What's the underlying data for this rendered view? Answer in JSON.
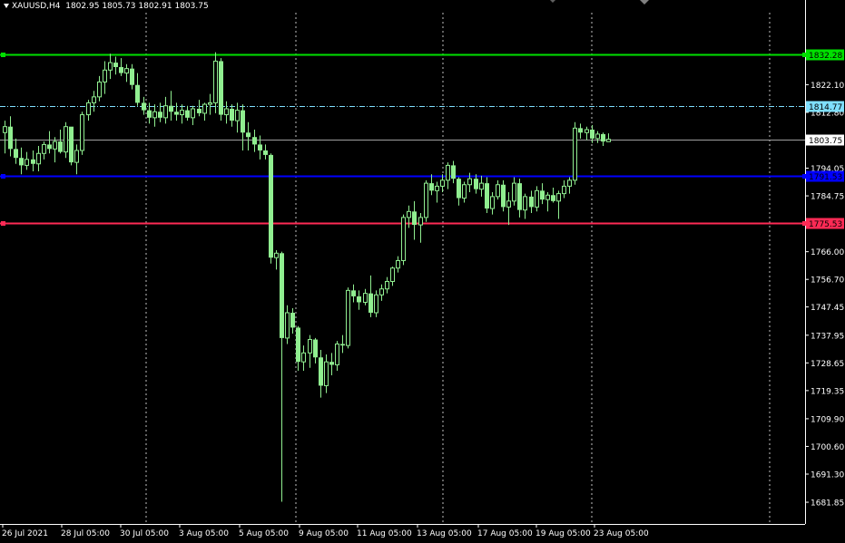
{
  "header": {
    "symbol": "XAUUSD,H4",
    "ohlc": "1802.95 1805.73 1802.91 1803.75"
  },
  "colors": {
    "background": "#000000",
    "candle": "#90ee90",
    "axis_text": "#ffffff",
    "grid": "#bfbfbf",
    "level_green": "#00e000",
    "level_cyan": "#7fdfff",
    "level_blue": "#0000ff",
    "level_red": "#ff2a55",
    "bid_line": "#a0a0a0"
  },
  "chart_data": {
    "type": "candlestick",
    "ylim": [
      1677.6,
      1841.4
    ],
    "y_ticks": [
      "1822.10",
      "1812.80",
      "1794.05",
      "1784.75",
      "1766.00",
      "1756.70",
      "1747.45",
      "1737.95",
      "1728.65",
      "1719.35",
      "1709.90",
      "1700.60",
      "1691.30",
      "1681.85"
    ],
    "x_ticks": [
      "26 Jul 2021",
      "28 Jul 05:00",
      "30 Jul 05:00",
      "3 Aug 05:00",
      "5 Aug 05:00",
      "9 Aug 05:00",
      "11 Aug 05:00",
      "13 Aug 05:00",
      "17 Aug 05:00",
      "19 Aug 05:00",
      "23 Aug 05:00"
    ],
    "levels": [
      {
        "price": 1832.28,
        "label": "1832.28",
        "style": "solid",
        "color": "level_green"
      },
      {
        "price": 1814.77,
        "label": "1814.77",
        "style": "dashdot",
        "color": "level_cyan"
      },
      {
        "price": 1803.75,
        "label": "1803.75",
        "style": "bid",
        "color": "bid_line"
      },
      {
        "price": 1791.53,
        "label": "1791.53",
        "style": "solid",
        "color": "level_blue"
      },
      {
        "price": 1775.53,
        "label": "1775.53",
        "style": "solid",
        "color": "level_red"
      }
    ],
    "candles": [
      [
        1806.0,
        1810.0,
        1799.0,
        1808.0
      ],
      [
        1808.0,
        1811.5,
        1798.0,
        1800.5
      ],
      [
        1800.5,
        1804.0,
        1795.5,
        1797.5
      ],
      [
        1797.5,
        1801.0,
        1792.0,
        1795.0
      ],
      [
        1795.0,
        1799.5,
        1793.5,
        1797.0
      ],
      [
        1797.0,
        1800.0,
        1793.0,
        1795.5
      ],
      [
        1795.5,
        1801.5,
        1793.0,
        1799.0
      ],
      [
        1799.0,
        1803.0,
        1797.0,
        1802.0
      ],
      [
        1802.0,
        1806.5,
        1799.0,
        1800.5
      ],
      [
        1800.5,
        1804.5,
        1796.0,
        1803.0
      ],
      [
        1803.0,
        1807.0,
        1799.0,
        1799.5
      ],
      [
        1799.5,
        1809.5,
        1797.5,
        1808.0
      ],
      [
        1808.0,
        1806.5,
        1795.0,
        1796.0
      ],
      [
        1796.0,
        1802.0,
        1792.0,
        1800.0
      ],
      [
        1800.0,
        1813.0,
        1798.5,
        1812.0
      ],
      [
        1812.0,
        1817.0,
        1810.0,
        1816.0
      ],
      [
        1816.0,
        1820.0,
        1813.0,
        1818.0
      ],
      [
        1818.0,
        1825.0,
        1816.5,
        1823.0
      ],
      [
        1823.0,
        1830.0,
        1819.0,
        1827.0
      ],
      [
        1827.0,
        1832.5,
        1824.0,
        1829.5
      ],
      [
        1829.5,
        1831.5,
        1825.5,
        1828.0
      ],
      [
        1828.0,
        1831.0,
        1825.0,
        1826.0
      ],
      [
        1826.0,
        1829.0,
        1823.0,
        1827.5
      ],
      [
        1827.5,
        1829.0,
        1820.5,
        1822.0
      ],
      [
        1822.0,
        1826.0,
        1815.0,
        1816.0
      ],
      [
        1816.0,
        1818.0,
        1812.0,
        1813.5
      ],
      [
        1813.5,
        1816.0,
        1809.0,
        1811.0
      ],
      [
        1811.0,
        1815.5,
        1808.0,
        1813.0
      ],
      [
        1813.0,
        1816.0,
        1809.5,
        1811.0
      ],
      [
        1811.0,
        1818.0,
        1809.0,
        1815.0
      ],
      [
        1815.0,
        1820.0,
        1810.0,
        1813.0
      ],
      [
        1813.0,
        1816.0,
        1810.0,
        1812.0
      ],
      [
        1812.0,
        1815.5,
        1809.0,
        1813.5
      ],
      [
        1813.5,
        1815.0,
        1810.0,
        1811.0
      ],
      [
        1811.0,
        1815.0,
        1808.5,
        1814.0
      ],
      [
        1814.0,
        1817.0,
        1811.5,
        1812.5
      ],
      [
        1812.5,
        1816.0,
        1810.0,
        1815.5
      ],
      [
        1815.5,
        1819.0,
        1812.0,
        1816.0
      ],
      [
        1816.0,
        1833.0,
        1812.5,
        1830.0
      ],
      [
        1830.0,
        1831.0,
        1810.0,
        1812.0
      ],
      [
        1812.0,
        1816.5,
        1809.0,
        1814.0
      ],
      [
        1814.0,
        1815.5,
        1808.0,
        1810.0
      ],
      [
        1810.0,
        1816.0,
        1806.0,
        1813.5
      ],
      [
        1813.5,
        1815.5,
        1800.0,
        1806.0
      ],
      [
        1806.0,
        1809.5,
        1800.0,
        1804.5
      ],
      [
        1804.5,
        1807.0,
        1799.5,
        1802.0
      ],
      [
        1802.0,
        1805.0,
        1797.0,
        1800.0
      ],
      [
        1800.0,
        1802.0,
        1797.0,
        1798.5
      ],
      [
        1798.5,
        1799.0,
        1762.0,
        1764.0
      ],
      [
        1764.0,
        1766.5,
        1760.0,
        1765.5
      ],
      [
        1765.5,
        1766.0,
        1682.0,
        1737.0
      ],
      [
        1737.0,
        1748.0,
        1735.0,
        1745.5
      ],
      [
        1745.5,
        1747.0,
        1738.5,
        1740.5
      ],
      [
        1740.5,
        1741.0,
        1726.0,
        1729.0
      ],
      [
        1729.0,
        1734.5,
        1726.0,
        1732.0
      ],
      [
        1732.0,
        1738.0,
        1727.0,
        1736.5
      ],
      [
        1736.5,
        1737.0,
        1728.5,
        1730.5
      ],
      [
        1730.5,
        1733.0,
        1717.0,
        1721.0
      ],
      [
        1721.0,
        1731.5,
        1718.5,
        1729.0
      ],
      [
        1729.0,
        1732.0,
        1724.5,
        1728.0
      ],
      [
        1728.0,
        1736.0,
        1726.0,
        1735.0
      ],
      [
        1735.0,
        1738.0,
        1732.0,
        1734.5
      ],
      [
        1734.5,
        1754.0,
        1733.5,
        1753.0
      ],
      [
        1753.0,
        1755.0,
        1749.0,
        1751.0
      ],
      [
        1751.0,
        1753.0,
        1746.5,
        1749.0
      ],
      [
        1749.0,
        1753.5,
        1748.0,
        1752.0
      ],
      [
        1752.0,
        1758.0,
        1744.0,
        1745.5
      ],
      [
        1745.5,
        1753.0,
        1744.0,
        1751.5
      ],
      [
        1751.5,
        1755.0,
        1749.5,
        1753.5
      ],
      [
        1753.5,
        1757.5,
        1752.0,
        1756.0
      ],
      [
        1756.0,
        1761.0,
        1754.5,
        1760.5
      ],
      [
        1760.5,
        1764.5,
        1759.0,
        1763.0
      ],
      [
        1763.0,
        1778.5,
        1761.5,
        1777.5
      ],
      [
        1777.5,
        1781.5,
        1774.0,
        1779.5
      ],
      [
        1779.5,
        1783.0,
        1770.0,
        1775.0
      ],
      [
        1775.0,
        1779.0,
        1769.0,
        1777.5
      ],
      [
        1777.5,
        1790.0,
        1776.0,
        1789.0
      ],
      [
        1789.0,
        1792.0,
        1785.0,
        1786.5
      ],
      [
        1786.5,
        1789.5,
        1782.5,
        1788.0
      ],
      [
        1788.0,
        1792.0,
        1786.0,
        1790.0
      ],
      [
        1790.0,
        1796.0,
        1787.0,
        1795.0
      ],
      [
        1795.0,
        1796.5,
        1789.0,
        1790.5
      ],
      [
        1790.5,
        1791.0,
        1781.5,
        1784.0
      ],
      [
        1784.0,
        1789.5,
        1782.5,
        1788.5
      ],
      [
        1788.5,
        1792.5,
        1786.0,
        1790.5
      ],
      [
        1790.5,
        1792.0,
        1785.5,
        1787.0
      ],
      [
        1787.0,
        1791.5,
        1784.5,
        1789.0
      ],
      [
        1789.0,
        1791.0,
        1779.0,
        1780.5
      ],
      [
        1780.5,
        1786.0,
        1778.5,
        1784.5
      ],
      [
        1784.5,
        1790.0,
        1783.5,
        1788.5
      ],
      [
        1788.5,
        1790.0,
        1779.5,
        1781.0
      ],
      [
        1781.0,
        1786.0,
        1775.0,
        1783.0
      ],
      [
        1783.0,
        1791.0,
        1781.5,
        1789.0
      ],
      [
        1789.0,
        1790.5,
        1777.5,
        1780.0
      ],
      [
        1780.0,
        1785.5,
        1777.0,
        1784.5
      ],
      [
        1784.5,
        1786.5,
        1779.0,
        1781.0
      ],
      [
        1781.0,
        1788.0,
        1779.5,
        1786.5
      ],
      [
        1786.5,
        1789.0,
        1782.0,
        1783.5
      ],
      [
        1783.5,
        1786.0,
        1779.5,
        1785.0
      ],
      [
        1785.0,
        1787.5,
        1782.5,
        1783.0
      ],
      [
        1783.0,
        1786.5,
        1777.0,
        1785.5
      ],
      [
        1785.5,
        1790.0,
        1784.0,
        1788.0
      ],
      [
        1788.0,
        1791.0,
        1785.5,
        1790.0
      ],
      [
        1790.0,
        1809.5,
        1788.5,
        1807.5
      ],
      [
        1807.5,
        1809.0,
        1804.0,
        1806.0
      ],
      [
        1806.0,
        1808.0,
        1803.5,
        1807.0
      ],
      [
        1807.0,
        1808.5,
        1802.5,
        1804.0
      ],
      [
        1804.0,
        1806.5,
        1802.5,
        1805.5
      ],
      [
        1805.5,
        1806.0,
        1801.5,
        1803.0
      ],
      [
        1802.95,
        1805.73,
        1802.91,
        1803.75
      ]
    ]
  }
}
